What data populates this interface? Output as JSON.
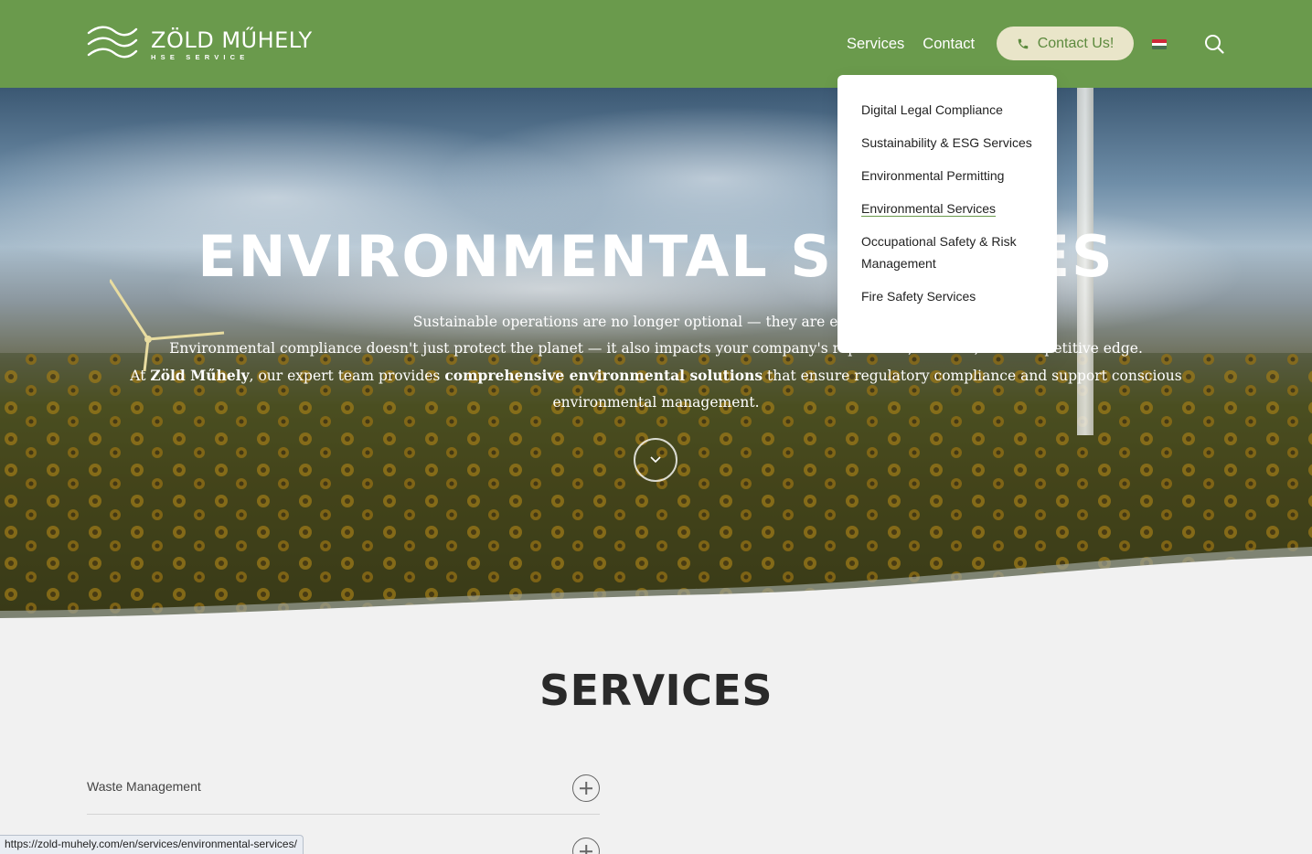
{
  "header": {
    "logo_name": "ZÖLD MŰHELY",
    "logo_sub": "HSE SERVICE",
    "nav": {
      "services": "Services",
      "contact": "Contact"
    },
    "cta_label": "Contact Us!",
    "flag_colors": [
      "#ce2939",
      "#ffffff",
      "#477050"
    ]
  },
  "dropdown": {
    "items": [
      "Digital Legal Compliance",
      "Sustainability & ESG Services",
      "Environmental Permitting",
      "Environmental Services",
      "Occupational Safety & Risk Management",
      "Fire Safety Services"
    ],
    "active_index": 3
  },
  "hero": {
    "title": "ENVIRONMENTAL SERVICES",
    "line1": "Sustainable operations are no longer optional — they are expected.",
    "line2": "Environmental compliance doesn't just protect the planet — it also impacts your company's reputation, licenses, and competitive edge.",
    "line3_pre": "At ",
    "line3_brand": "Zöld Műhely",
    "line3_mid": ", our expert team provides ",
    "line3_bold": "comprehensive environmental solutions",
    "line3_post": " that ensure regulatory compliance and support conscious environmental management."
  },
  "services": {
    "title": "SERVICES",
    "accordion": [
      "Waste Management",
      ""
    ]
  },
  "status_bar": {
    "url": "https://zold-muhely.com/en/services/environmental-services/"
  },
  "colors": {
    "brand_green": "#6a9a4c",
    "cta_bg": "#e9e5c9"
  }
}
